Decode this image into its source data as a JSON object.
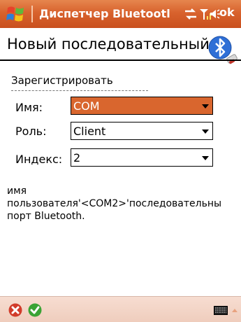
{
  "topbar": {
    "app_title": "Диспетчер Bluetootl",
    "ok_label": "ok"
  },
  "header": {
    "page_title": "Новый последовательный пор"
  },
  "form": {
    "group_label": "Зарегистрировать",
    "fields": [
      {
        "label": "Имя:",
        "value": "COM"
      },
      {
        "label": "Роль:",
        "value": "Client"
      },
      {
        "label": "Индекс:",
        "value": "2"
      }
    ]
  },
  "description": {
    "line1": "имя",
    "line2": "пользователя'<COM2>'последовательны",
    "line3": "порт Bluetooth."
  },
  "colors": {
    "accent": "#d9662e",
    "bottombar": "#f5d8ca"
  }
}
